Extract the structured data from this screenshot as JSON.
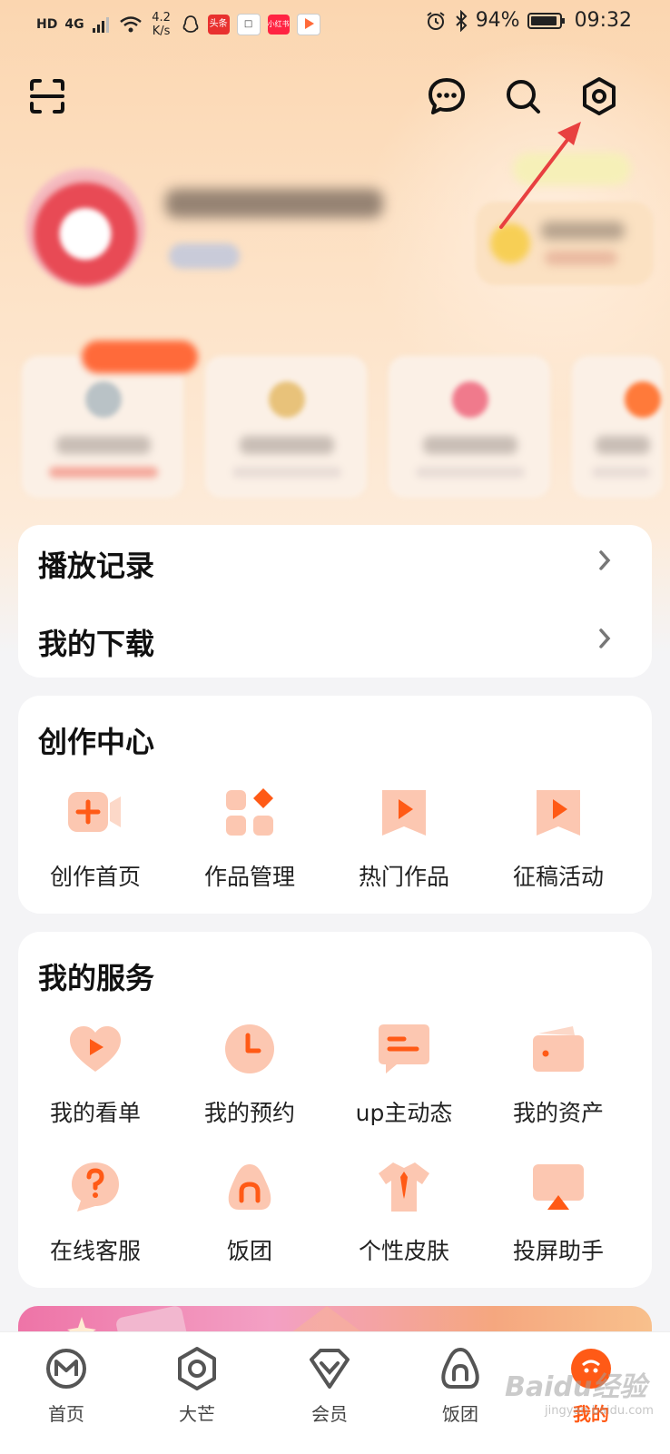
{
  "status_bar": {
    "hd": "HD",
    "network": "4G",
    "speed_value": "4.2",
    "speed_unit": "K/s",
    "apps": [
      {
        "name": "toutiao",
        "label": "头条",
        "color": "#e8312f"
      },
      {
        "name": "news",
        "label": "",
        "color": "#ffffff"
      },
      {
        "name": "xiaohongshu",
        "label": "小红书",
        "color": "#ff2442"
      },
      {
        "name": "video",
        "label": "",
        "color": "#ffffff"
      }
    ],
    "battery": "94%",
    "time": "09:32"
  },
  "header": {
    "icons": [
      "scan-icon",
      "message-icon",
      "search-icon",
      "settings-icon"
    ]
  },
  "colors": {
    "accent": "#ff5a16",
    "accent_light": "#fcc7b1",
    "card": "#ffffff"
  },
  "history_card": {
    "rows": [
      {
        "label": "播放记录"
      },
      {
        "label": "我的下载"
      }
    ]
  },
  "creation_center": {
    "title": "创作中心",
    "items": [
      {
        "label": "创作首页",
        "icon": "video-camera-plus-icon"
      },
      {
        "label": "作品管理",
        "icon": "grid-icon"
      },
      {
        "label": "热门作品",
        "icon": "play-bookmark-icon"
      },
      {
        "label": "征稿活动",
        "icon": "play-bookmark-icon"
      }
    ]
  },
  "my_services": {
    "title": "我的服务",
    "items": [
      {
        "label": "我的看单",
        "icon": "heart-play-icon"
      },
      {
        "label": "我的预约",
        "icon": "clock-icon"
      },
      {
        "label": "up主动态",
        "icon": "chat-bubble-icon"
      },
      {
        "label": "我的资产",
        "icon": "wallet-icon"
      },
      {
        "label": "在线客服",
        "icon": "help-bubble-icon"
      },
      {
        "label": "饭团",
        "icon": "rice-ball-icon"
      },
      {
        "label": "个性皮肤",
        "icon": "shirt-icon"
      },
      {
        "label": "投屏助手",
        "icon": "cast-screen-icon"
      }
    ]
  },
  "tab_bar": {
    "tabs": [
      {
        "label": "首页",
        "icon": "home-m-icon",
        "active": false
      },
      {
        "label": "大芒",
        "icon": "big-mango-icon",
        "active": false
      },
      {
        "label": "会员",
        "icon": "vip-diamond-icon",
        "active": false
      },
      {
        "label": "饭团",
        "icon": "rice-ball-tab-icon",
        "active": false
      },
      {
        "label": "我的",
        "icon": "mine-avatar-icon",
        "active": true
      }
    ]
  },
  "watermark": {
    "text": "Baidu经验",
    "sub": "jingyan.baidu.com"
  }
}
